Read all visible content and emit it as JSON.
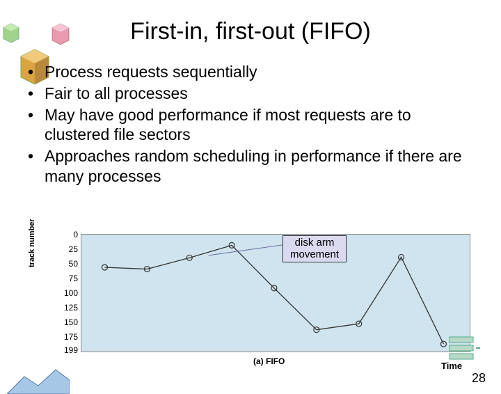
{
  "title": "First-in, first-out (FIFO)",
  "bullets": [
    "Process requests sequentially",
    "Fair to all processes",
    "May have good performance if most requests are to clustered file sectors",
    "Approaches random scheduling in performance if there are many processes"
  ],
  "callout": {
    "line1": "disk arm",
    "line2": "movement"
  },
  "chart_data": {
    "type": "line",
    "title": "",
    "xlabel": "Time",
    "ylabel": "track number",
    "caption": "(a) FIFO",
    "ylim": [
      0,
      199
    ],
    "yticks": [
      0,
      25,
      50,
      75,
      100,
      125,
      150,
      175,
      199
    ],
    "x": [
      1,
      2,
      3,
      4,
      5,
      6,
      7,
      8,
      9
    ],
    "values": [
      55,
      58,
      39,
      18,
      90,
      160,
      150,
      38,
      184
    ],
    "bg_color": "#cfe4ee"
  },
  "slide_number": "28"
}
